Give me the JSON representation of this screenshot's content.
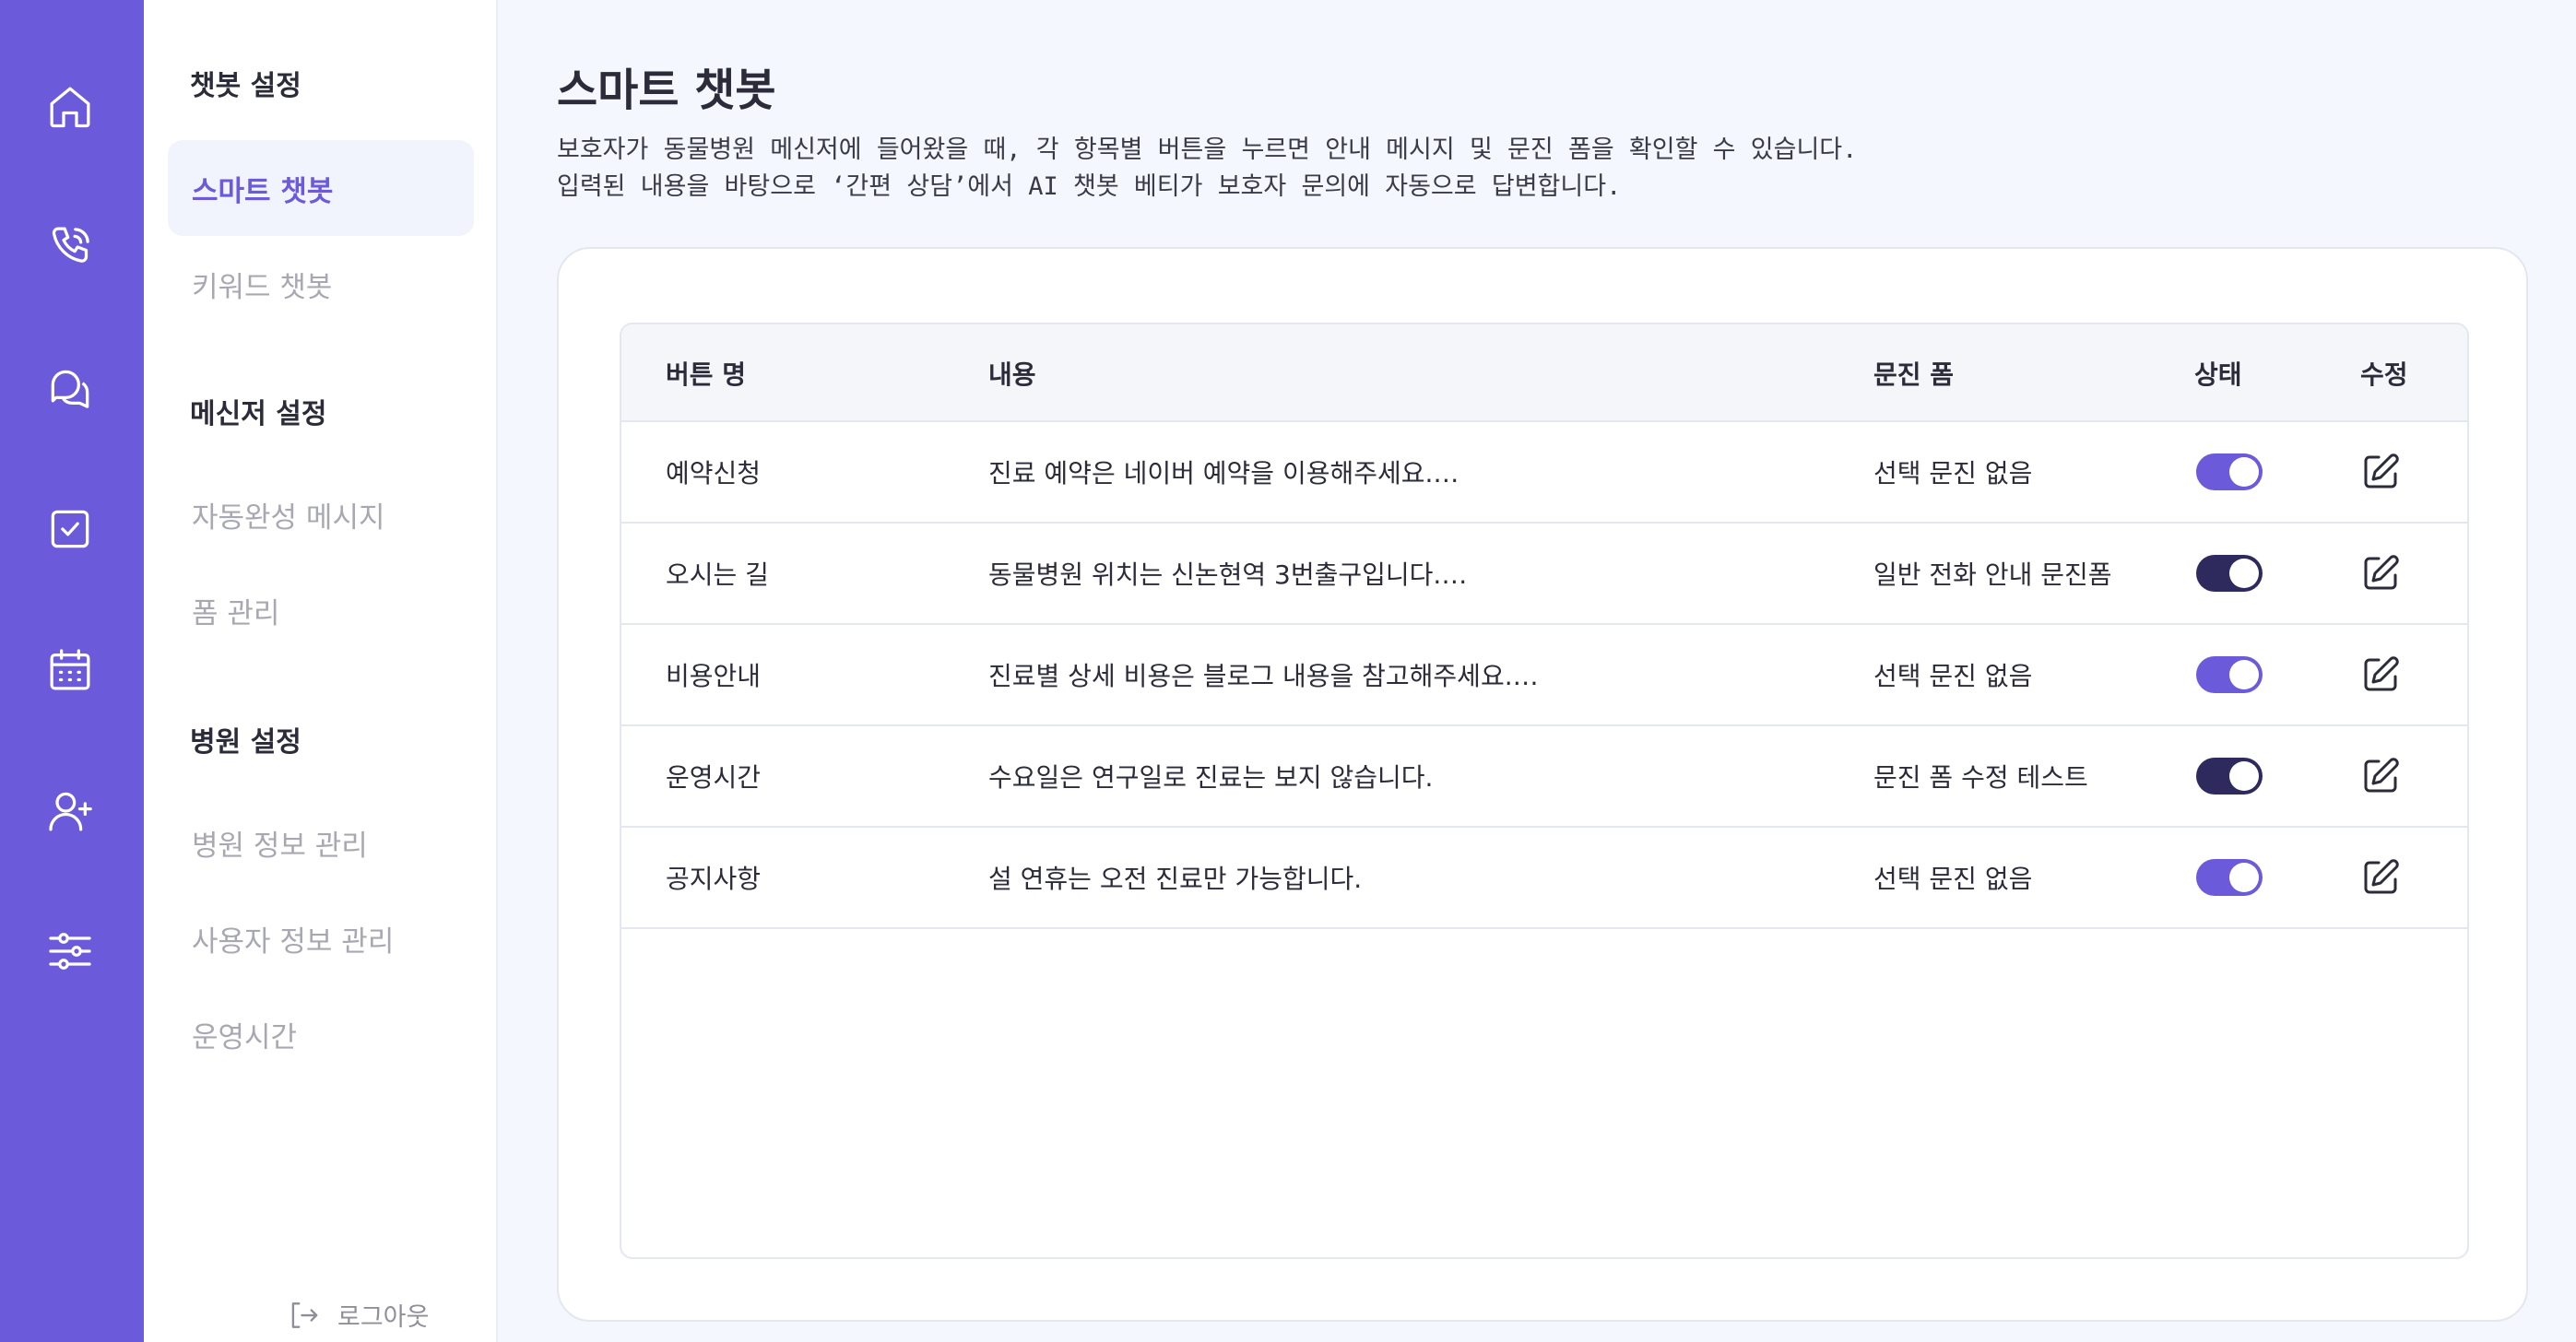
{
  "colors": {
    "rail_bg": "#6b5ad9",
    "accent": "#6b5ad9",
    "toggle_on_light": "#6b5ad9",
    "toggle_on_dark": "#2e2a5e"
  },
  "rail": {
    "icons": [
      "home-icon",
      "phone-icon",
      "chat-icon",
      "checkbox-icon",
      "calendar-icon",
      "add-user-icon",
      "sliders-icon"
    ]
  },
  "subnav": {
    "section_chatbot": "챗봇 설정",
    "item_smart": "스마트 챗봇",
    "item_keyword": "키워드 챗봇",
    "section_messenger": "메신저 설정",
    "item_autocomplete": "자동완성 메시지",
    "item_forms": "폼 관리",
    "section_hospital": "병원 설정",
    "item_hospital_info": "병원 정보 관리",
    "item_user_info": "사용자 정보 관리",
    "item_hours": "운영시간",
    "logout": "로그아웃"
  },
  "main": {
    "title": "스마트 챗봇",
    "desc_line1": "보호자가 동물병원 메신저에 들어왔을 때, 각 항목별 버튼을 누르면 안내 메시지 및 문진 폼을 확인할 수 있습니다.",
    "desc_line2": "입력된 내용을 바탕으로 ‘간편 상담’에서 AI 챗봇 베티가 보호자 문의에 자동으로 답변합니다."
  },
  "table": {
    "headers": {
      "name": "버튼 명",
      "content": "내용",
      "form": "문진 폼",
      "status": "상태",
      "edit": "수정"
    },
    "rows": [
      {
        "name": "예약신청",
        "content": "진료 예약은 네이버 예약을 이용해주세요.…",
        "form": "선택 문진 없음",
        "status": "on-light"
      },
      {
        "name": "오시는 길",
        "content": "동물병원 위치는 신논현역 3번출구입니다.…",
        "form": "일반 전화 안내 문진폼",
        "status": "on-dark"
      },
      {
        "name": "비용안내",
        "content": "진료별 상세 비용은 블로그 내용을 참고해주세요.…",
        "form": "선택 문진 없음",
        "status": "on-light"
      },
      {
        "name": "운영시간",
        "content": "수요일은 연구일로 진료는 보지 않습니다.",
        "form": "문진 폼 수정 테스트",
        "status": "on-dark"
      },
      {
        "name": "공지사항",
        "content": "설 연휴는 오전 진료만 가능합니다.",
        "form": "선택 문진 없음",
        "status": "on-light"
      }
    ]
  }
}
